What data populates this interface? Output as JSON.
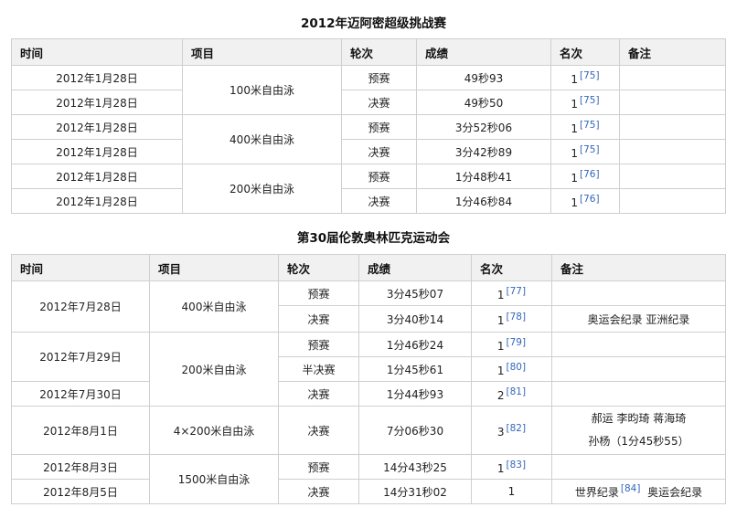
{
  "tables": [
    {
      "caption": "2012年迈阿密超级挑战赛",
      "headers": [
        "时间",
        "项目",
        "轮次",
        "成绩",
        "名次",
        "备注"
      ],
      "rows": [
        {
          "date": "2012年1月28日",
          "event": "100米自由泳",
          "round": "预赛",
          "result": "49秒93",
          "rank": "1",
          "ref": "[75]",
          "note": ""
        },
        {
          "date": "2012年1月28日",
          "round": "决赛",
          "result": "49秒50",
          "rank": "1",
          "ref": "[75]",
          "note": ""
        },
        {
          "date": "2012年1月28日",
          "event": "400米自由泳",
          "round": "预赛",
          "result": "3分52秒06",
          "rank": "1",
          "ref": "[75]",
          "note": ""
        },
        {
          "date": "2012年1月28日",
          "round": "决赛",
          "result": "3分42秒89",
          "rank": "1",
          "ref": "[75]",
          "note": ""
        },
        {
          "date": "2012年1月28日",
          "event": "200米自由泳",
          "round": "预赛",
          "result": "1分48秒41",
          "rank": "1",
          "ref": "[76]",
          "note": ""
        },
        {
          "date": "2012年1月28日",
          "round": "决赛",
          "result": "1分46秒84",
          "rank": "1",
          "ref": "[76]",
          "note": ""
        }
      ]
    },
    {
      "caption": "第30届伦敦奥林匹克运动会",
      "headers": [
        "时间",
        "项目",
        "轮次",
        "成绩",
        "名次",
        "备注"
      ],
      "rows": [
        {
          "date": "2012年7月28日",
          "event": "400米自由泳",
          "round": "预赛",
          "result": "3分45秒07",
          "rank": "1",
          "ref": "[77]",
          "note": ""
        },
        {
          "round": "决赛",
          "result": "3分40秒14",
          "rank": "1",
          "ref": "[78]",
          "note": "奥运会纪录 亚洲纪录"
        },
        {
          "date": "2012年7月29日",
          "event": "200米自由泳",
          "round": "预赛",
          "result": "1分46秒24",
          "rank": "1",
          "ref": "[79]",
          "note": ""
        },
        {
          "round": "半决赛",
          "result": "1分45秒61",
          "rank": "1",
          "ref": "[80]",
          "note": ""
        },
        {
          "date": "2012年7月30日",
          "round": "决赛",
          "result": "1分44秒93",
          "rank": "2",
          "ref": "[81]",
          "note": ""
        },
        {
          "date": "2012年8月1日",
          "event": "4×200米自由泳",
          "round": "决赛",
          "result": "7分06秒30",
          "rank": "3",
          "ref": "[82]",
          "note_lines": [
            "郝运 李昀琦 蒋海琦",
            "孙杨（1分45秒55）"
          ]
        },
        {
          "date": "2012年8月3日",
          "event": "1500米自由泳",
          "round": "预赛",
          "result": "14分43秒25",
          "rank": "1",
          "ref": "[83]",
          "note": ""
        },
        {
          "date": "2012年8月5日",
          "round": "决赛",
          "result": "14分31秒02",
          "rank": "1",
          "note_pre": "世界纪录",
          "note_ref": "[84]",
          "note_post": "奥运会纪录"
        }
      ]
    }
  ]
}
